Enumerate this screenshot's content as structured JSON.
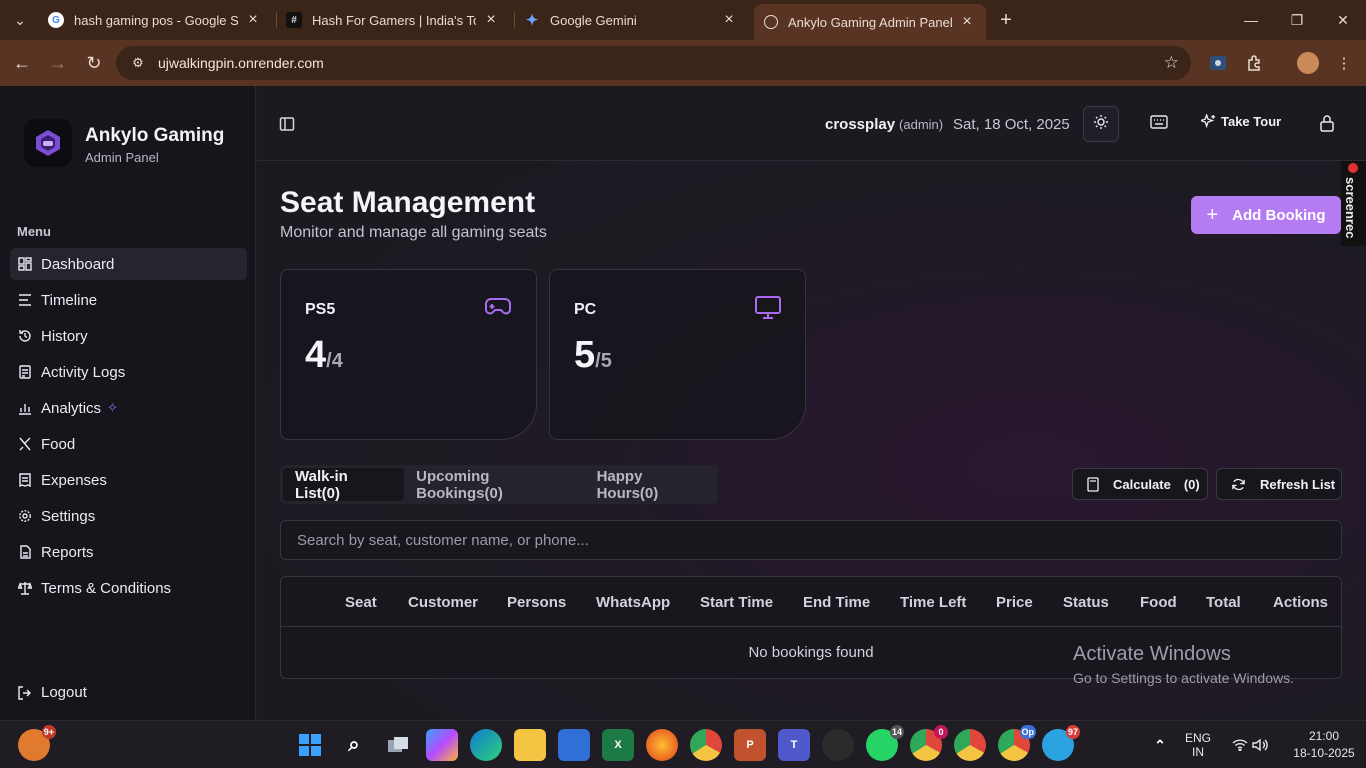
{
  "browser": {
    "tabs": [
      {
        "title": "hash gaming pos - Google Sear",
        "favicon": "google-g-icon",
        "active": false
      },
      {
        "title": "Hash For Gamers | India's Top G",
        "favicon": "hash-logo-icon",
        "active": false
      },
      {
        "title": "Google Gemini",
        "favicon": "gemini-sparkle-icon",
        "active": false
      },
      {
        "title": "Ankylo Gaming Admin Panel",
        "favicon": "globe-icon",
        "active": true
      }
    ],
    "url": "ujwalkingpin.onrender.com"
  },
  "sidebar": {
    "brand_name": "Ankylo Gaming",
    "brand_sub": "Admin Panel",
    "menu_heading": "Menu",
    "items": [
      {
        "label": "Dashboard",
        "icon": "dashboard-grid-icon",
        "active": true
      },
      {
        "label": "Timeline",
        "icon": "timeline-icon"
      },
      {
        "label": "History",
        "icon": "history-icon"
      },
      {
        "label": "Activity Logs",
        "icon": "clipboard-icon"
      },
      {
        "label": "Analytics",
        "icon": "bar-chart-icon",
        "sparkle": "✧"
      },
      {
        "label": "Food",
        "icon": "utensils-icon"
      },
      {
        "label": "Expenses",
        "icon": "receipt-icon"
      },
      {
        "label": "Settings",
        "icon": "gear-icon"
      },
      {
        "label": "Reports",
        "icon": "report-icon"
      },
      {
        "label": "Terms & Conditions",
        "icon": "scale-icon"
      }
    ],
    "logout": "Logout"
  },
  "header": {
    "username": "crossplay",
    "role": "(admin)",
    "date": "Sat, 18 Oct, 2025",
    "take_tour": "Take Tour"
  },
  "page": {
    "title": "Seat Management",
    "subtitle": "Monitor and manage all gaming seats",
    "add_booking": "Add Booking"
  },
  "screenrec": "screenrec",
  "cards": [
    {
      "title": "PS5",
      "available": "4",
      "total": "/4",
      "icon": "gamepad-icon"
    },
    {
      "title": "PC",
      "available": "5",
      "total": "/5",
      "icon": "monitor-icon"
    }
  ],
  "list_tabs": [
    {
      "label": "Walk-in List(0)",
      "active": true
    },
    {
      "label": "Upcoming Bookings(0)",
      "active": false
    },
    {
      "label": "Happy Hours(0)",
      "active": false
    }
  ],
  "actions": {
    "calculate": "Calculate",
    "calculate_count": "(0)",
    "refresh": "Refresh List"
  },
  "search": {
    "placeholder": "Search by seat, customer name, or phone..."
  },
  "table": {
    "columns": [
      "Seat",
      "Customer",
      "Persons",
      "WhatsApp",
      "Start Time",
      "End Time",
      "Time Left",
      "Price",
      "Status",
      "Food",
      "Total",
      "Actions"
    ],
    "empty_message": "No bookings found"
  },
  "watermark": {
    "line1": "Activate Windows",
    "line2": "Go to Settings to activate Windows."
  },
  "taskbar": {
    "weather_badge": "9+",
    "whatsapp_badge": "14",
    "chrome_badge_1": "0",
    "chrome_badge_2": "Op",
    "telegram_badge": "97",
    "lang_1": "ENG",
    "lang_2": "IN",
    "time": "21:00",
    "date": "18-10-2025"
  },
  "colors": {
    "accent": "#b57bf3",
    "sidebar_bg": "#15151b",
    "browser_chrome": "#5a3422"
  }
}
